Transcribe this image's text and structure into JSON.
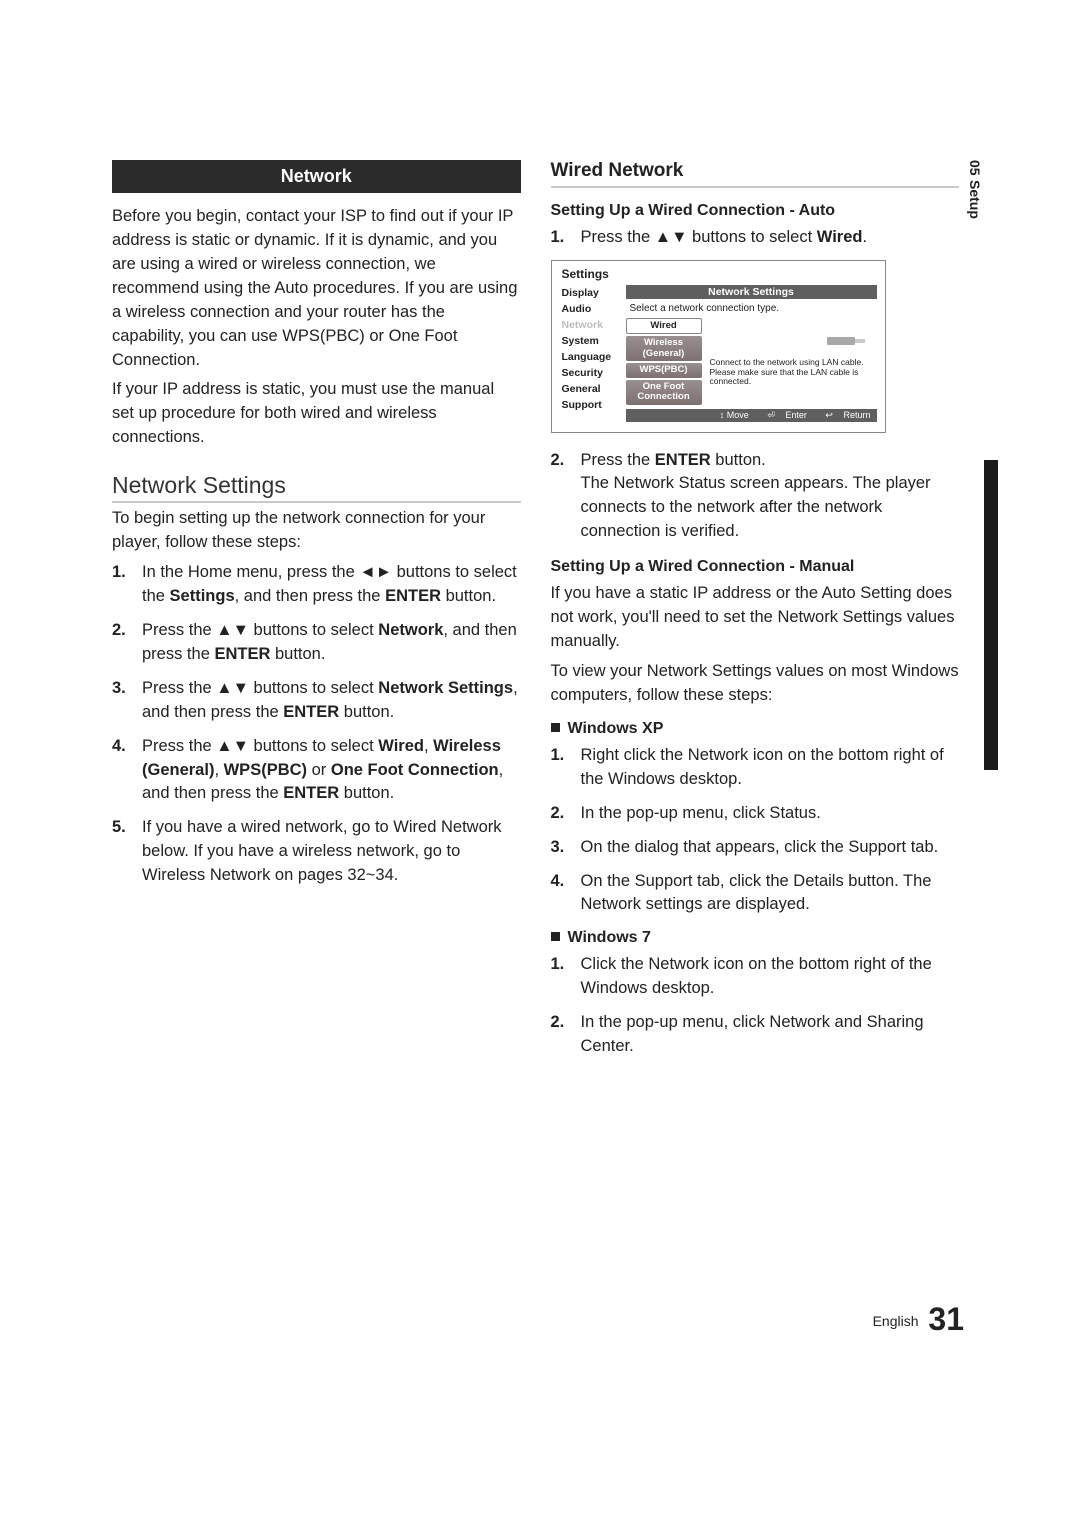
{
  "side": {
    "chapter": "05",
    "label": "Setup"
  },
  "footer": {
    "lang": "English",
    "page": "31"
  },
  "left": {
    "banner": "Network",
    "intro1": "Before you begin, contact your ISP to find out if your IP address is static or dynamic. If it is dynamic, and you are using a wired or wireless connection, we recommend using the Auto procedures. If you are using a wireless connection and your router has the capability, you can use WPS(PBC) or One Foot Connection.",
    "intro2": "If your IP address is static, you must use the manual set up procedure for both wired and wireless connections.",
    "h2": "Network Settings",
    "p2": "To begin setting up the network connection for your player, follow these steps:",
    "steps": [
      "In the Home menu, press the ◄► buttons to select the <b>Settings</b>, and then press the <b>ENTER</b> button.",
      "Press the ▲▼ buttons to select <b>Network</b>, and then press the <b>ENTER</b> button.",
      "Press the ▲▼ buttons to select <b>Network Settings</b>, and then press the <b>ENTER</b> button.",
      "Press the ▲▼ buttons to select <b>Wired</b>, <b>Wireless (General)</b>, <b>WPS(PBC)</b> or <b>One Foot Connection</b>, and then press the <b>ENTER</b> button.",
      "If you have a wired network, go to Wired Network below. If you have a wireless network, go to Wireless Network on pages 32~34."
    ]
  },
  "right": {
    "h3": "Wired Network",
    "h4a": "Setting Up a Wired Connection - Auto",
    "step1": "Press the ▲▼ buttons to select <b>Wired</b>.",
    "step2": "Press the <b>ENTER</b> button.<br>The Network Status screen appears. The player connects to the network after the network connection is verified.",
    "h4b": "Setting Up a Wired Connection - Manual",
    "pManual1": "If you have a static IP address or the Auto Setting does not work, you'll need to set the Network Settings values manually.",
    "pManual2": "To view your Network Settings values on most Windows computers, follow these steps:",
    "winxp_label": "Windows XP",
    "winxp": [
      "Right click the Network icon on the bottom right of the Windows desktop.",
      "In the pop-up menu, click Status.",
      "On the dialog that appears, click the Support tab.",
      "On the Support tab, click the Details button. The Network settings are displayed."
    ],
    "win7_label": "Windows 7",
    "win7": [
      "Click the Network icon on the bottom right of the Windows desktop.",
      "In the pop-up menu, click Network and Sharing Center."
    ]
  },
  "tv": {
    "window": "Settings",
    "banner": "Network Settings",
    "instruction": "Select a network connection type.",
    "menu": [
      "Display",
      "Audio",
      "Network",
      "System",
      "Language",
      "Security",
      "General",
      "Support"
    ],
    "opts": [
      "Wired",
      "Wireless (General)",
      "WPS(PBC)",
      "One Foot Connection"
    ],
    "hint": "Connect to the network using LAN cable. Please make sure that the LAN cable is connected.",
    "foot": {
      "move": "> Move",
      "enter": "Enter",
      "ret": "Return"
    },
    "foot_glyphs": {
      "move": "↕",
      "enter": "⏎",
      "ret": "↩"
    }
  }
}
